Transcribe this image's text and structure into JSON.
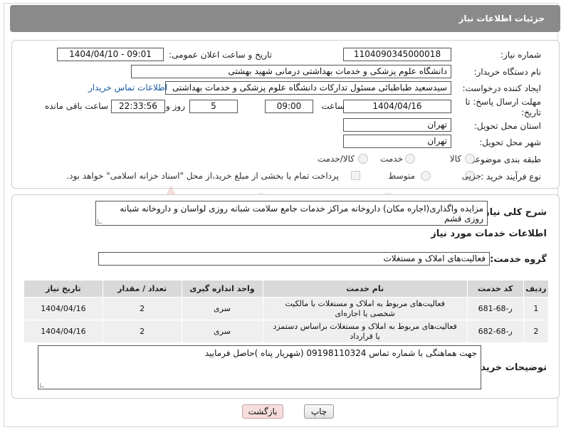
{
  "header": {
    "title": "جزئیات اطلاعات نیاز"
  },
  "form": {
    "need_number_label": "شماره نیاز:",
    "need_number": "1104090345000018",
    "announce_label": "تاریخ و ساعت اعلان عمومی:",
    "announce_value": "1404/04/10 - 09:01",
    "buyer_org_label": "نام دستگاه خریدار:",
    "buyer_org": "دانشگاه علوم پزشکی و خدمات بهداشتی درمانی شهید بهشتی",
    "requester_label": "ایجاد کننده درخواست:",
    "requester": "سیدسعید طباطبائی مسئول تدارکات دانشگاه علوم پزشکی و خدمات بهداشتی",
    "contact_link": "اطلاعات تماس خریدار",
    "deadline_label_1": "مهلت ارسال پاسخ: تا",
    "deadline_label_2": "تاریخ:",
    "deadline_date": "1404/04/16",
    "time_label": "ساعت",
    "deadline_time": "09:00",
    "days_value": "5",
    "days_label": "روز و",
    "remaining_time": "22:33:56",
    "remaining_label": "ساعت باقی مانده",
    "province_label": "استان محل تحویل:",
    "province": "تهران",
    "city_label": "شهر محل تحویل:",
    "city": "تهران",
    "category_label": "طبقه بندی موضوعی:",
    "category_options": [
      "کالا",
      "خدمت",
      "کالا/خدمت"
    ],
    "process_label": "نوع فرآیند خرید :",
    "process_options": [
      "جزیی",
      "متوسط"
    ],
    "payment_note": "پرداخت تمام یا بخشی از مبلغ خرید،از محل \"اسناد خزانه اسلامی\" خواهد بود."
  },
  "details": {
    "description_label": "شرح کلی نیاز:",
    "description": "مزایده واگذاری(اجاره مکان) داروخانه مراکز خدمات جامع سلامت شبانه روزی لواسان و داروخانه شبانه روزی قشم",
    "services_heading": "اطلاعات خدمات مورد نیاز",
    "service_group_label": "گروه خدمت:",
    "service_group": "فعالیت‌های  املاک و مستغلات",
    "table": {
      "headers": [
        "ردیف",
        "کد خدمت",
        "نام خدمت",
        "واحد اندازه گیری",
        "تعداد / مقدار",
        "تاریخ نیاز"
      ],
      "rows": [
        [
          "1",
          "ر-68-681",
          "فعالیت‌های مربوط به املاک و مستغلات با مالکیت شخصی یا اجاره‌ای",
          "سری",
          "2",
          "1404/04/16"
        ],
        [
          "2",
          "ر-68-682",
          "فعالیت‌های مربوط به املاک و مستغلات براساس دستمزد یا قرارداد",
          "سری",
          "2",
          "1404/04/16"
        ]
      ]
    },
    "buyer_notes_label": "توضیحات خریدار:",
    "buyer_notes": "جهت هماهنگی با شماره تماس 09198110324 (شهریار پناه )حاصل فرمایید"
  },
  "actions": {
    "print_label": "چاپ",
    "back_label": "بازگشت"
  },
  "watermark_text": "AriaTender.neT"
}
